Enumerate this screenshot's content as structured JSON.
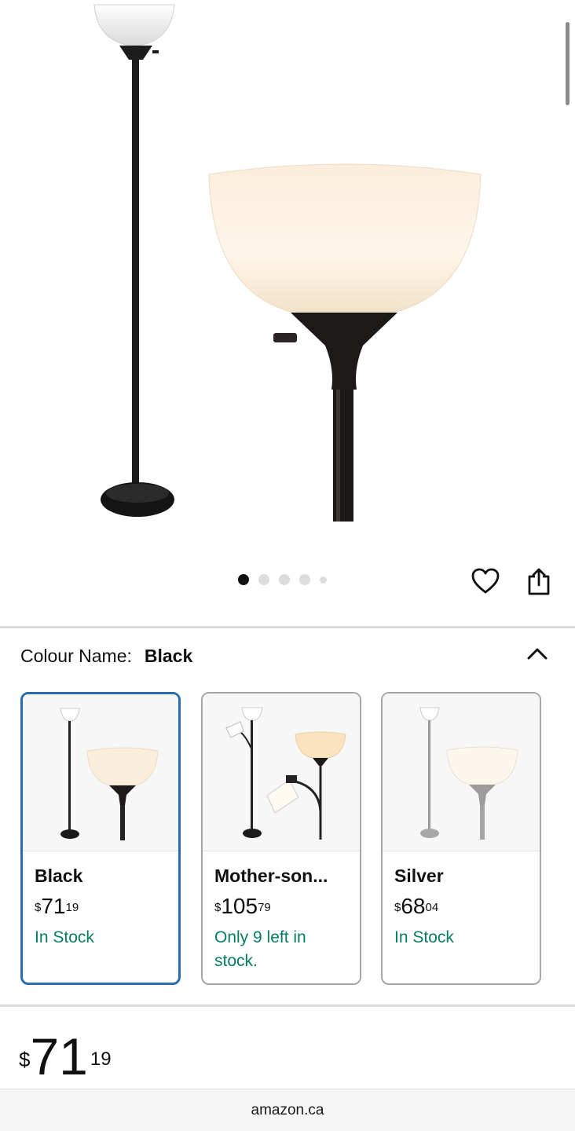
{
  "gallery": {
    "image_count": 5,
    "active_index": 0,
    "actions": {
      "favorite_icon": "heart-icon",
      "share_icon": "share-icon"
    }
  },
  "variation": {
    "label": "Colour Name:",
    "selected_value": "Black",
    "toggle_icon": "chevron-up-icon",
    "options": [
      {
        "name": "Black",
        "price_currency": "$",
        "price_whole": "71",
        "price_fraction": "19",
        "stock": "In Stock",
        "selected": true
      },
      {
        "name": "Mother-son...",
        "price_currency": "$",
        "price_whole": "105",
        "price_fraction": "79",
        "stock": "Only 9 left in stock.",
        "selected": false
      },
      {
        "name": "Silver",
        "price_currency": "$",
        "price_whole": "68",
        "price_fraction": "04",
        "stock": "In Stock",
        "selected": false
      }
    ]
  },
  "price": {
    "currency": "$",
    "whole": "71",
    "fraction": "19"
  },
  "browser": {
    "url": "amazon.ca"
  },
  "colors": {
    "selected_border": "#2b6cb0",
    "in_stock": "#067d62"
  }
}
